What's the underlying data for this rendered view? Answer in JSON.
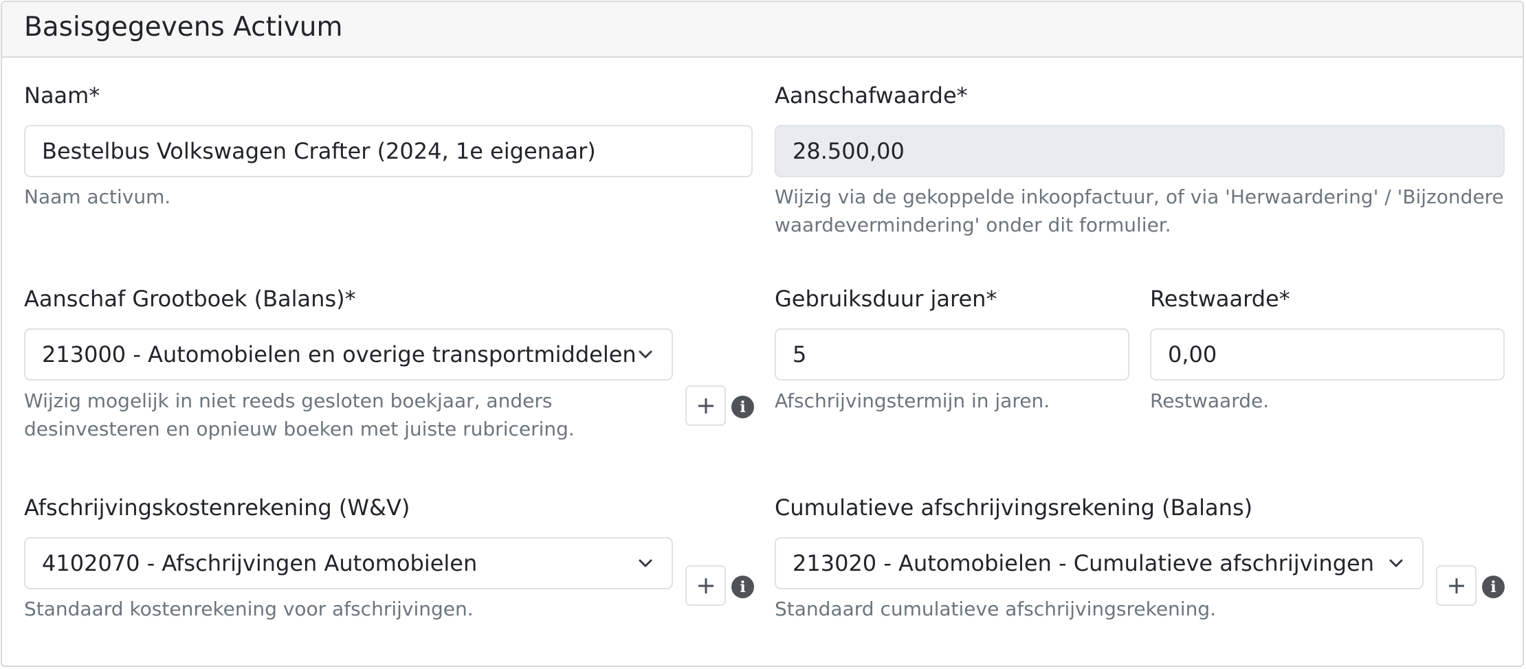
{
  "card": {
    "title": "Basisgegevens Activum"
  },
  "naam": {
    "label": "Naam*",
    "value": "Bestelbus Volkswagen Crafter (2024, 1e eigenaar)",
    "help": "Naam activum."
  },
  "aanschafwaarde": {
    "label": "Aanschafwaarde*",
    "value": "28.500,00",
    "help_line1": "Wijzig via de gekoppelde inkoopfactuur, of via 'Herwaardering' / 'Bijzondere",
    "help_line2": "waardevermindering' onder dit formulier."
  },
  "grootboek": {
    "label": "Aanschaf Grootboek (Balans)*",
    "selected": "213000 - Automobielen en overige transportmiddelen",
    "help_line1": "Wijzig mogelijk in niet reeds gesloten boekjaar, anders",
    "help_line2": "desinvesteren en opnieuw boeken met juiste rubricering.",
    "add_icon": "plus-icon",
    "info_icon": "info-icon"
  },
  "gebruiksduur": {
    "label": "Gebruiksduur jaren*",
    "value": "5",
    "help": "Afschrijvingstermijn in jaren."
  },
  "restwaarde": {
    "label": "Restwaarde*",
    "value": "0,00",
    "help": "Restwaarde."
  },
  "kostenrekening": {
    "label": "Afschrijvingskostenrekening (W&V)",
    "selected": "4102070 - Afschrijvingen Automobielen",
    "help": "Standaard kostenrekening voor afschrijvingen.",
    "add_icon": "plus-icon",
    "info_icon": "info-icon"
  },
  "cumulatief": {
    "label": "Cumulatieve afschrijvingsrekening (Balans)",
    "selected": "213020 - Automobielen - Cumulatieve afschrijvingen",
    "help": "Standaard cumulatieve afschrijvingsrekening.",
    "add_icon": "plus-icon",
    "info_icon": "info-icon"
  },
  "icons": {
    "info_glyph": "i"
  },
  "colors": {
    "header_bg": "#f7f7f7",
    "border": "#dee2e6",
    "readonly_bg": "#e9ecef",
    "help_text": "#6c757d",
    "info_icon_bg": "#4f5257"
  }
}
